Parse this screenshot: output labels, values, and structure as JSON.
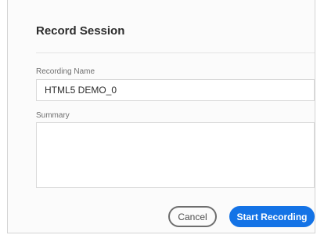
{
  "dialog": {
    "title": "Record Session",
    "recording_name": {
      "label": "Recording Name",
      "value": "HTML5 DEMO_0"
    },
    "summary": {
      "label": "Summary",
      "value": ""
    },
    "buttons": {
      "cancel": "Cancel",
      "start": "Start Recording"
    }
  },
  "colors": {
    "accent": "#1473e6"
  }
}
